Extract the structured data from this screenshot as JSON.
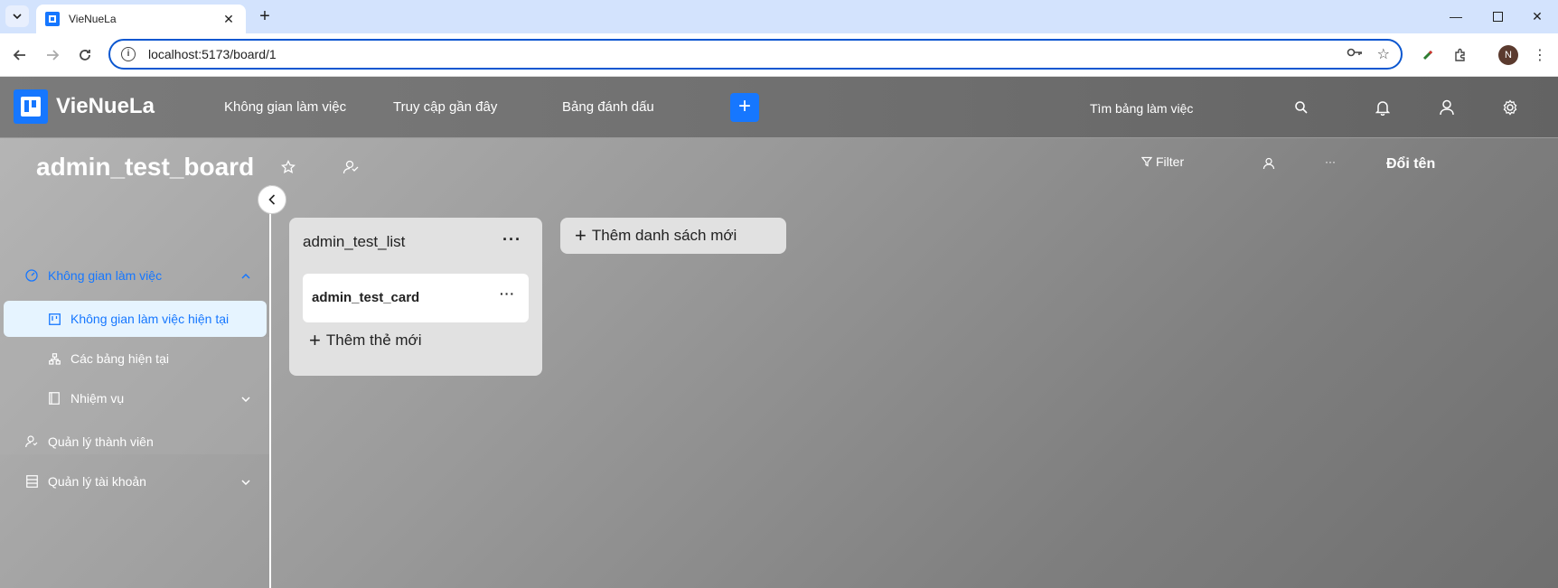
{
  "browser": {
    "tab_title": "VieNueLa",
    "url": "localhost:5173/board/1"
  },
  "app": {
    "logo": "VieNueLa",
    "nav": [
      "Không gian làm việc",
      "Truy cập gần đây",
      "Bảng đánh dấu"
    ],
    "search_label": "Tìm bảng làm việc",
    "accent": "#1677ff"
  },
  "board": {
    "title": "admin_test_board",
    "filter_label": "Filter",
    "more_label": "···",
    "rename_label": "Đổi tên"
  },
  "sidebar": {
    "workspace": "Không gian làm việc",
    "current_workspace": "Không gian làm việc hiện tại",
    "current_boards": "Các bảng hiện tại",
    "tasks": "Nhiệm vụ",
    "members": "Quản lý thành viên",
    "accounts": "Quản lý tài khoản"
  },
  "lists": [
    {
      "title": "admin_test_list",
      "cards": [
        {
          "title": "admin_test_card"
        }
      ],
      "add_card_label": "Thêm thẻ mới"
    }
  ],
  "add_list_label": "Thêm danh sách mới"
}
